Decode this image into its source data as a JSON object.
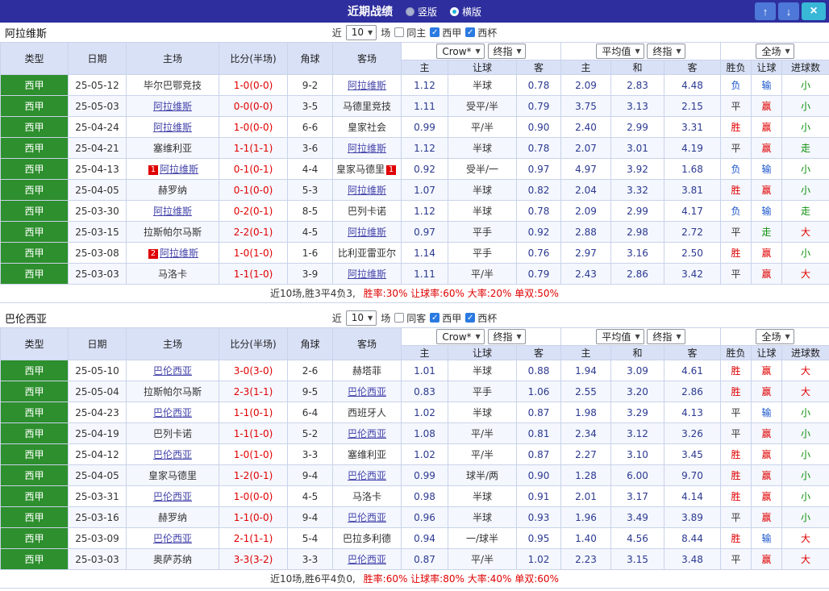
{
  "titlebar": {
    "title": "近期战绩",
    "radios": [
      {
        "label": "竖版",
        "checked": false
      },
      {
        "label": "横版",
        "checked": true
      }
    ],
    "up_icon": "↑",
    "down_icon": "↓",
    "close_icon": "×"
  },
  "sections": [
    {
      "team": "阿拉维斯",
      "filters": {
        "near_label": "近",
        "count": "10",
        "games_label": "场",
        "checkboxes": [
          {
            "label": "同主",
            "checked": false
          },
          {
            "label": "西甲",
            "checked": true
          },
          {
            "label": "西杯",
            "checked": true
          }
        ]
      },
      "selects": {
        "bookmaker": "Crow*",
        "asia_final": "终指",
        "europe_avg": "平均值",
        "europe_final": "终指",
        "scope": "全场"
      },
      "header": {
        "type": "类型",
        "date": "日期",
        "home": "主场",
        "score": "比分(半场)",
        "corner": "角球",
        "away": "客场",
        "sub": [
          "主",
          "让球",
          "客",
          "主",
          "和",
          "客",
          "胜负",
          "让球",
          "进球数"
        ]
      },
      "rows": [
        {
          "type": "西甲",
          "date": "25-05-12",
          "home": "毕尔巴鄂竞技",
          "homeFocus": false,
          "homeCard": "",
          "score": "1-0(0-0)",
          "corner": "9-2",
          "away": "阿拉维斯",
          "awayFocus": true,
          "awayCard": "",
          "asia": [
            "1.12",
            "半球",
            "0.78"
          ],
          "europe": [
            "2.09",
            "2.83",
            "4.48"
          ],
          "results": [
            "负",
            "输",
            "小"
          ]
        },
        {
          "type": "西甲",
          "date": "25-05-03",
          "home": "阿拉维斯",
          "homeFocus": true,
          "homeCard": "",
          "score": "0-0(0-0)",
          "corner": "3-5",
          "away": "马德里竞技",
          "awayFocus": false,
          "awayCard": "",
          "asia": [
            "1.11",
            "受平/半",
            "0.79"
          ],
          "europe": [
            "3.75",
            "3.13",
            "2.15"
          ],
          "results": [
            "平",
            "赢",
            "小"
          ]
        },
        {
          "type": "西甲",
          "date": "25-04-24",
          "home": "阿拉维斯",
          "homeFocus": true,
          "homeCard": "",
          "score": "1-0(0-0)",
          "corner": "6-6",
          "away": "皇家社会",
          "awayFocus": false,
          "awayCard": "",
          "asia": [
            "0.99",
            "平/半",
            "0.90"
          ],
          "europe": [
            "2.40",
            "2.99",
            "3.31"
          ],
          "results": [
            "胜",
            "赢",
            "小"
          ]
        },
        {
          "type": "西甲",
          "date": "25-04-21",
          "home": "塞维利亚",
          "homeFocus": false,
          "homeCard": "",
          "score": "1-1(1-1)",
          "corner": "3-6",
          "away": "阿拉维斯",
          "awayFocus": true,
          "awayCard": "",
          "asia": [
            "1.12",
            "半球",
            "0.78"
          ],
          "europe": [
            "2.07",
            "3.01",
            "4.19"
          ],
          "results": [
            "平",
            "赢",
            "走"
          ]
        },
        {
          "type": "西甲",
          "date": "25-04-13",
          "home": "阿拉维斯",
          "homeFocus": true,
          "homeCard": "1",
          "score": "0-1(0-1)",
          "corner": "4-4",
          "away": "皇家马德里",
          "awayFocus": false,
          "awayCard": "1",
          "asia": [
            "0.92",
            "受半/一",
            "0.97"
          ],
          "europe": [
            "4.97",
            "3.92",
            "1.68"
          ],
          "results": [
            "负",
            "输",
            "小"
          ]
        },
        {
          "type": "西甲",
          "date": "25-04-05",
          "home": "赫罗纳",
          "homeFocus": false,
          "homeCard": "",
          "score": "0-1(0-0)",
          "corner": "5-3",
          "away": "阿拉维斯",
          "awayFocus": true,
          "awayCard": "",
          "asia": [
            "1.07",
            "半球",
            "0.82"
          ],
          "europe": [
            "2.04",
            "3.32",
            "3.81"
          ],
          "results": [
            "胜",
            "赢",
            "小"
          ]
        },
        {
          "type": "西甲",
          "date": "25-03-30",
          "home": "阿拉维斯",
          "homeFocus": true,
          "homeCard": "",
          "score": "0-2(0-1)",
          "corner": "8-5",
          "away": "巴列卡诺",
          "awayFocus": false,
          "awayCard": "",
          "asia": [
            "1.12",
            "半球",
            "0.78"
          ],
          "europe": [
            "2.09",
            "2.99",
            "4.17"
          ],
          "results": [
            "负",
            "输",
            "走"
          ]
        },
        {
          "type": "西甲",
          "date": "25-03-15",
          "home": "拉斯帕尔马斯",
          "homeFocus": false,
          "homeCard": "",
          "score": "2-2(0-1)",
          "corner": "4-5",
          "away": "阿拉维斯",
          "awayFocus": true,
          "awayCard": "",
          "asia": [
            "0.97",
            "平手",
            "0.92"
          ],
          "europe": [
            "2.88",
            "2.98",
            "2.72"
          ],
          "results": [
            "平",
            "走",
            "大"
          ]
        },
        {
          "type": "西甲",
          "date": "25-03-08",
          "home": "阿拉维斯",
          "homeFocus": true,
          "homeCard": "2",
          "score": "1-0(1-0)",
          "corner": "1-6",
          "away": "比利亚雷亚尔",
          "awayFocus": false,
          "awayCard": "",
          "asia": [
            "1.14",
            "平手",
            "0.76"
          ],
          "europe": [
            "2.97",
            "3.16",
            "2.50"
          ],
          "results": [
            "胜",
            "赢",
            "小"
          ]
        },
        {
          "type": "西甲",
          "date": "25-03-03",
          "home": "马洛卡",
          "homeFocus": false,
          "homeCard": "",
          "score": "1-1(1-0)",
          "corner": "3-9",
          "away": "阿拉维斯",
          "awayFocus": true,
          "awayCard": "",
          "asia": [
            "1.11",
            "平/半",
            "0.79"
          ],
          "europe": [
            "2.43",
            "2.86",
            "3.42"
          ],
          "results": [
            "平",
            "赢",
            "大"
          ]
        }
      ],
      "summary": {
        "record": "近10场,胜3平4负3,",
        "rates": "胜率:30% 让球率:60% 大率:20% 单双:50%"
      }
    },
    {
      "team": "巴伦西亚",
      "filters": {
        "near_label": "近",
        "count": "10",
        "games_label": "场",
        "checkboxes": [
          {
            "label": "同客",
            "checked": false
          },
          {
            "label": "西甲",
            "checked": true
          },
          {
            "label": "西杯",
            "checked": true
          }
        ]
      },
      "selects": {
        "bookmaker": "Crow*",
        "asia_final": "终指",
        "europe_avg": "平均值",
        "europe_final": "终指",
        "scope": "全场"
      },
      "header": {
        "type": "类型",
        "date": "日期",
        "home": "主场",
        "score": "比分(半场)",
        "corner": "角球",
        "away": "客场",
        "sub": [
          "主",
          "让球",
          "客",
          "主",
          "和",
          "客",
          "胜负",
          "让球",
          "进球数"
        ]
      },
      "rows": [
        {
          "type": "西甲",
          "date": "25-05-10",
          "home": "巴伦西亚",
          "homeFocus": true,
          "homeCard": "",
          "score": "3-0(3-0)",
          "corner": "2-6",
          "away": "赫塔菲",
          "awayFocus": false,
          "awayCard": "",
          "asia": [
            "1.01",
            "半球",
            "0.88"
          ],
          "europe": [
            "1.94",
            "3.09",
            "4.61"
          ],
          "results": [
            "胜",
            "赢",
            "大"
          ]
        },
        {
          "type": "西甲",
          "date": "25-05-04",
          "home": "拉斯帕尔马斯",
          "homeFocus": false,
          "homeCard": "",
          "score": "2-3(1-1)",
          "corner": "9-5",
          "away": "巴伦西亚",
          "awayFocus": true,
          "awayCard": "",
          "asia": [
            "0.83",
            "平手",
            "1.06"
          ],
          "europe": [
            "2.55",
            "3.20",
            "2.86"
          ],
          "results": [
            "胜",
            "赢",
            "大"
          ]
        },
        {
          "type": "西甲",
          "date": "25-04-23",
          "home": "巴伦西亚",
          "homeFocus": true,
          "homeCard": "",
          "score": "1-1(0-1)",
          "corner": "6-4",
          "away": "西班牙人",
          "awayFocus": false,
          "awayCard": "",
          "asia": [
            "1.02",
            "半球",
            "0.87"
          ],
          "europe": [
            "1.98",
            "3.29",
            "4.13"
          ],
          "results": [
            "平",
            "输",
            "小"
          ]
        },
        {
          "type": "西甲",
          "date": "25-04-19",
          "home": "巴列卡诺",
          "homeFocus": false,
          "homeCard": "",
          "score": "1-1(1-0)",
          "corner": "5-2",
          "away": "巴伦西亚",
          "awayFocus": true,
          "awayCard": "",
          "asia": [
            "1.08",
            "平/半",
            "0.81"
          ],
          "europe": [
            "2.34",
            "3.12",
            "3.26"
          ],
          "results": [
            "平",
            "赢",
            "小"
          ]
        },
        {
          "type": "西甲",
          "date": "25-04-12",
          "home": "巴伦西亚",
          "homeFocus": true,
          "homeCard": "",
          "score": "1-0(1-0)",
          "corner": "3-3",
          "away": "塞维利亚",
          "awayFocus": false,
          "awayCard": "",
          "asia": [
            "1.02",
            "平/半",
            "0.87"
          ],
          "europe": [
            "2.27",
            "3.10",
            "3.45"
          ],
          "results": [
            "胜",
            "赢",
            "小"
          ]
        },
        {
          "type": "西甲",
          "date": "25-04-05",
          "home": "皇家马德里",
          "homeFocus": false,
          "homeCard": "",
          "score": "1-2(0-1)",
          "corner": "9-4",
          "away": "巴伦西亚",
          "awayFocus": true,
          "awayCard": "",
          "asia": [
            "0.99",
            "球半/两",
            "0.90"
          ],
          "europe": [
            "1.28",
            "6.00",
            "9.70"
          ],
          "results": [
            "胜",
            "赢",
            "小"
          ]
        },
        {
          "type": "西甲",
          "date": "25-03-31",
          "home": "巴伦西亚",
          "homeFocus": true,
          "homeCard": "",
          "score": "1-0(0-0)",
          "corner": "4-5",
          "away": "马洛卡",
          "awayFocus": false,
          "awayCard": "",
          "asia": [
            "0.98",
            "半球",
            "0.91"
          ],
          "europe": [
            "2.01",
            "3.17",
            "4.14"
          ],
          "results": [
            "胜",
            "赢",
            "小"
          ]
        },
        {
          "type": "西甲",
          "date": "25-03-16",
          "home": "赫罗纳",
          "homeFocus": false,
          "homeCard": "",
          "score": "1-1(0-0)",
          "corner": "9-4",
          "away": "巴伦西亚",
          "awayFocus": true,
          "awayCard": "",
          "asia": [
            "0.96",
            "半球",
            "0.93"
          ],
          "europe": [
            "1.96",
            "3.49",
            "3.89"
          ],
          "results": [
            "平",
            "赢",
            "小"
          ]
        },
        {
          "type": "西甲",
          "date": "25-03-09",
          "home": "巴伦西亚",
          "homeFocus": true,
          "homeCard": "",
          "score": "2-1(1-1)",
          "corner": "5-4",
          "away": "巴拉多利德",
          "awayFocus": false,
          "awayCard": "",
          "asia": [
            "0.94",
            "一/球半",
            "0.95"
          ],
          "europe": [
            "1.40",
            "4.56",
            "8.44"
          ],
          "results": [
            "胜",
            "输",
            "大"
          ]
        },
        {
          "type": "西甲",
          "date": "25-03-03",
          "home": "奥萨苏纳",
          "homeFocus": false,
          "homeCard": "",
          "score": "3-3(3-2)",
          "corner": "3-3",
          "away": "巴伦西亚",
          "awayFocus": true,
          "awayCard": "",
          "asia": [
            "0.87",
            "平/半",
            "1.02"
          ],
          "europe": [
            "2.23",
            "3.15",
            "3.48"
          ],
          "results": [
            "平",
            "赢",
            "大"
          ]
        }
      ],
      "summary": {
        "record": "近10场,胜6平4负0,",
        "rates": "胜率:60% 让球率:80% 大率:40% 单双:60%"
      }
    }
  ]
}
